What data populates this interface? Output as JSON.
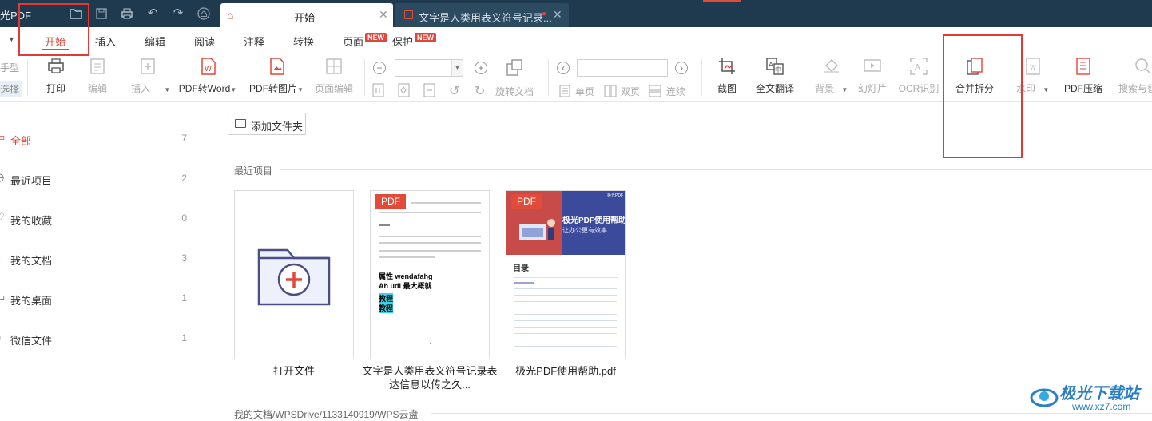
{
  "app": {
    "title": "光PDF"
  },
  "tabs": [
    {
      "label": "开始"
    },
    {
      "label": "文字是人类用表义符号记录..."
    }
  ],
  "menu": {
    "items": [
      "开始",
      "插入",
      "编辑",
      "阅读",
      "注释",
      "转换",
      "页面",
      "保护"
    ],
    "new_badge": "NEW"
  },
  "toolbar": {
    "left_partial": [
      "手型",
      "选择"
    ],
    "print": "打印",
    "edit": "编辑",
    "insert": "插入",
    "pdf_to_word": "PDF转Word",
    "pdf_to_image": "PDF转图片",
    "page_edit": "页面编辑",
    "rotate_doc": "旋转文档",
    "single_page": "单页",
    "double_page": "双页",
    "continuous": "连续",
    "screenshot": "截图",
    "full_translate": "全文翻译",
    "background": "背景",
    "slideshow": "幻灯片",
    "ocr": "OCR识别",
    "merge_split": "合并拆分",
    "watermark": "水印",
    "pdf_compress": "PDF压缩",
    "search_partial": "搜索与替"
  },
  "sidebar": {
    "items": [
      {
        "label": "全部",
        "count": "7",
        "icon": "file-icon"
      },
      {
        "label": "最近项目",
        "count": "2",
        "icon": "clock-icon"
      },
      {
        "label": "我的收藏",
        "count": "0",
        "icon": "heart-icon"
      },
      {
        "label": "我的文档",
        "count": "3",
        "icon": "doc-icon"
      },
      {
        "label": "我的桌面",
        "count": "1",
        "icon": "desktop-icon"
      },
      {
        "label": "微信文件",
        "count": "1",
        "icon": "wechat-icon"
      }
    ]
  },
  "main": {
    "add_folder": "添加文件夹",
    "recent_title": "最近项目",
    "cards": [
      {
        "label": "打开文件"
      },
      {
        "label": "文字是人类用表义符号记录表达信息以传之久..."
      },
      {
        "label": "极光PDF使用帮助.pdf"
      }
    ],
    "pdf_tag": "PDF",
    "doc_preview": {
      "line1": "属性 wendafahg",
      "line2": "Ah udi 最大概就",
      "hl1": "教程",
      "hl2": "教程"
    },
    "help_preview": {
      "title": "极光PDF使用帮助",
      "subtitle": "让办公更有效率",
      "toc": "目录",
      "brand": "极光PDF"
    },
    "path_title": "我的文档/WPSDrive/1133140919/WPS云盘"
  },
  "watermark": {
    "text": "极光下载站",
    "url": "www.xz7.com"
  },
  "colors": {
    "titlebar": "#1f3a4f",
    "accent": "#e0473a",
    "highlight_frame": "#e53935"
  }
}
